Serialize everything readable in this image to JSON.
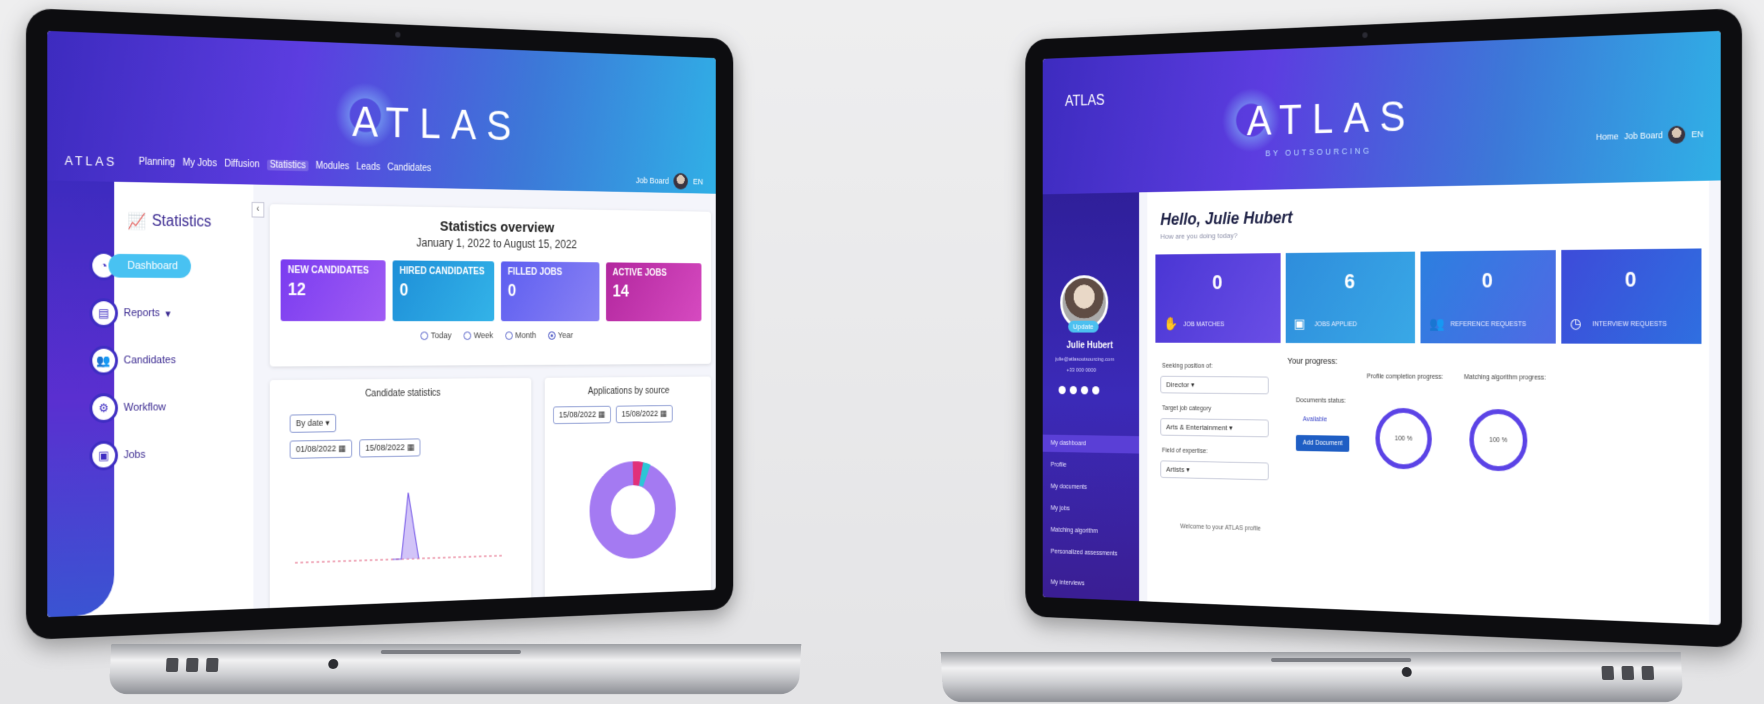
{
  "left": {
    "brand": "ATLAS",
    "logo_text": "ATLAS",
    "nav": [
      "Planning",
      "My Jobs",
      "Diffusion",
      "Statistics",
      "Modules",
      "Leads",
      "Candidates"
    ],
    "nav_active": "Statistics",
    "user_label": "Job Board",
    "lang": "EN",
    "sidebar": {
      "title": "Statistics",
      "items": [
        {
          "label": "Dashboard",
          "icon": "dashboard-icon",
          "active": true
        },
        {
          "label": "Reports",
          "icon": "report-icon",
          "caret": "▾"
        },
        {
          "label": "Candidates",
          "icon": "users-icon"
        },
        {
          "label": "Workflow",
          "icon": "gears-icon"
        },
        {
          "label": "Jobs",
          "icon": "briefcase-icon"
        }
      ]
    },
    "overview": {
      "title": "Statistics overview",
      "date_from": "January 1, 2022",
      "to": "to",
      "date_to": "August 15, 2022",
      "tiles": [
        {
          "label": "NEW CANDIDATES",
          "value": "12"
        },
        {
          "label": "HIRED CANDIDATES",
          "value": "0"
        },
        {
          "label": "FILLED JOBS",
          "value": "0"
        },
        {
          "label": "ACTIVE JOBS",
          "value": "14"
        }
      ],
      "periods": [
        "Today",
        "Week",
        "Month",
        "Year"
      ],
      "period_selected": "Year"
    },
    "candidate_stats": {
      "title": "Candidate statistics",
      "filter": "By date",
      "from": "01/08/2022",
      "to": "15/08/2022"
    },
    "applications": {
      "title": "Applications by source",
      "from": "15/08/2022",
      "to": "15/08/2022"
    }
  },
  "right": {
    "brand": "ATLAS",
    "logo_text": "ATLAS",
    "byline": "BY OUTSOURCING",
    "nav": [
      "Home",
      "Job Board"
    ],
    "lang": "EN",
    "profile": {
      "update": "Update",
      "name": "Julie Hubert",
      "email": "julie@atlasoutsourcing.com",
      "phone": "+33 000 0000"
    },
    "menu": [
      "My dashboard",
      "Profile",
      "My documents",
      "My jobs",
      "Matching algorithm",
      "Personalized assessments",
      "My interviews"
    ],
    "greeting": "Hello, Julie Hubert",
    "greeting_sub": "How are you doing today?",
    "tiles": [
      {
        "value": "0",
        "label": "JOB MATCHES"
      },
      {
        "value": "6",
        "label": "JOBS APPLIED"
      },
      {
        "value": "0",
        "label": "REFERENCE REQUESTS"
      },
      {
        "value": "0",
        "label": "INTERVIEW REQUESTS"
      }
    ],
    "form": {
      "seeking_label": "Seeking position of:",
      "seeking_value": "Director",
      "category_label": "Target job category",
      "category_value": "Arts & Entertainment",
      "expertise_label": "Field of expertise:",
      "expertise_value": "Artists"
    },
    "progress": {
      "title": "Your progress:",
      "documents_label": "Documents status:",
      "documents_status": "Available",
      "add_button": "Add Document",
      "profile_label": "Profile completion progress:",
      "profile_value": "100 %",
      "algorithm_label": "Matching algorithm progress:",
      "algorithm_value": "100 %"
    },
    "welcome": "Welcome to your ATLAS profile"
  }
}
